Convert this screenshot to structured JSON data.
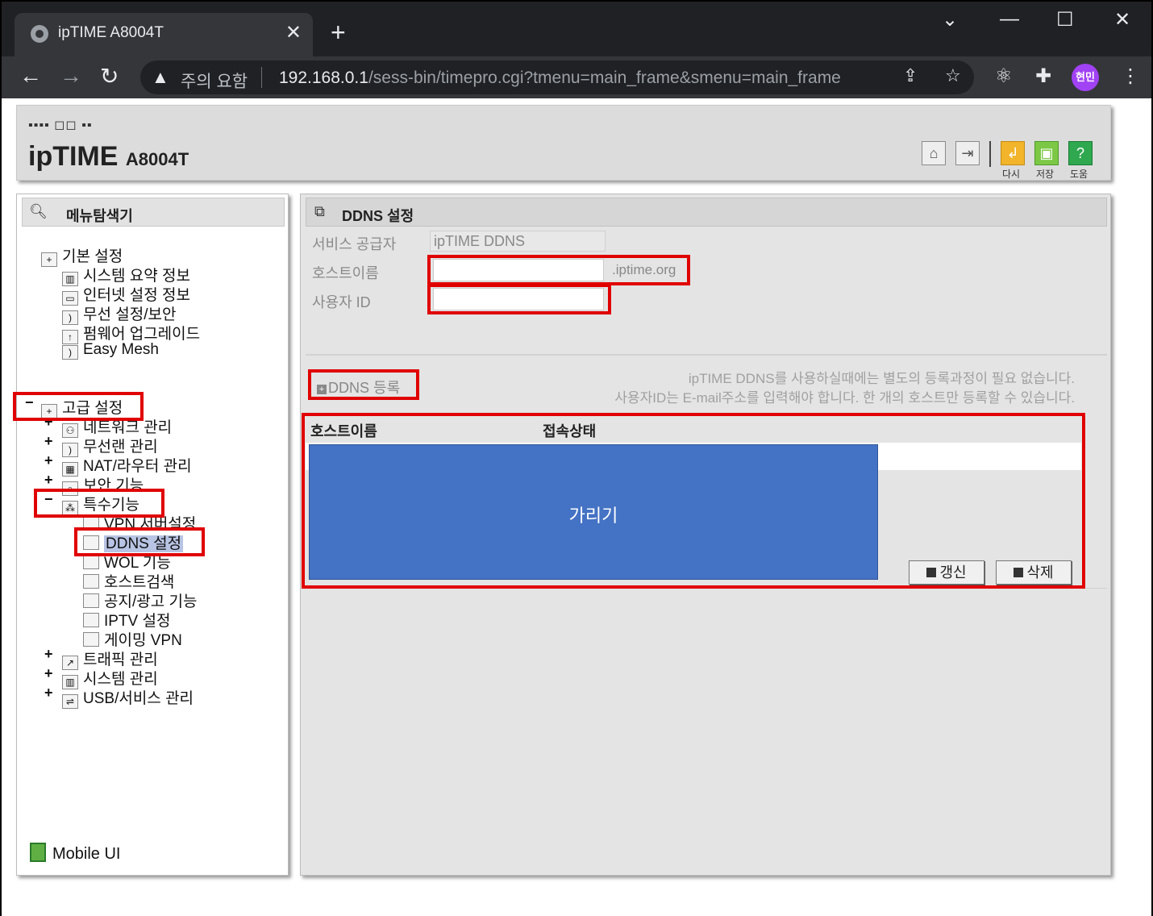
{
  "browser": {
    "tab_title": "ipTIME A8004T",
    "tab_close": "✕",
    "new_tab": "+",
    "security_warning": "주의 요함",
    "url_host": "192.168.0.1",
    "url_path": "/sess-bin/timepro.cgi?tmenu=main_frame&smenu=main_frame",
    "profile_name": "현민"
  },
  "header": {
    "logo_text": "ipTIME",
    "model": "A8004T",
    "buttons": [
      {
        "label": "다시",
        "icon": "reload-icon"
      },
      {
        "label": "저장",
        "icon": "save-icon"
      },
      {
        "label": "도움",
        "icon": "help-icon"
      }
    ]
  },
  "sidebar": {
    "title": "메뉴탐색기",
    "basic": {
      "label": "기본 설정",
      "items": [
        "시스템 요약 정보",
        "인터넷 설정 정보",
        "무선 설정/보안",
        "펌웨어 업그레이드",
        "Easy Mesh"
      ]
    },
    "advanced": {
      "label": "고급 설정",
      "items": [
        "네트워크 관리",
        "무선랜 관리",
        "NAT/라우터 관리",
        "보안 기능"
      ],
      "special": {
        "label": "특수기능",
        "items": [
          "VPN 서버설정",
          "DDNS 설정",
          "WOL 기능",
          "호스트검색",
          "공지/광고 기능",
          "IPTV 설정",
          "게이밍 VPN"
        ]
      },
      "more": [
        "트래픽 관리",
        "시스템 관리",
        "USB/서비스 관리"
      ]
    },
    "mobile_ui": "Mobile UI"
  },
  "main": {
    "title": "DDNS 설정",
    "service_provider_label": "서비스 공급자",
    "service_provider_value": "ipTIME DDNS",
    "hostname_label": "호스트이름",
    "hostname_value": "",
    "hostname_suffix": ".iptime.org",
    "userid_label": "사용자 ID",
    "userid_value": "",
    "register_label": "DDNS 등록",
    "notice_line1": "ipTIME DDNS를 사용하실때에는 별도의 등록과정이 필요 없습니다.",
    "notice_line2": "사용자ID는 E-mail주소를 입력해야 합니다. 한 개의 호스트만 등록할 수 있습니다.",
    "table": {
      "columns": [
        "호스트이름",
        "접속상태"
      ]
    },
    "mask_text": "가리기",
    "refresh_label": "갱신",
    "delete_label": "삭제"
  }
}
